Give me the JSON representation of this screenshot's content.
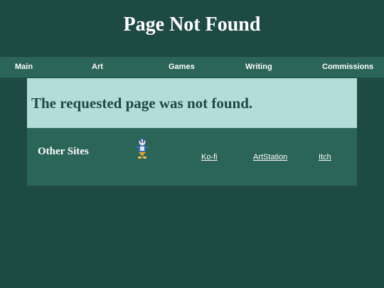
{
  "header": {
    "title": "Page Not Found"
  },
  "nav": {
    "items": [
      {
        "label": "Main"
      },
      {
        "label": "Art"
      },
      {
        "label": "Games"
      },
      {
        "label": "Writing"
      },
      {
        "label": "Commissions"
      }
    ]
  },
  "error": {
    "message": "The requested page was not found."
  },
  "other_sites": {
    "heading": "Other Sites",
    "mascot_icon": "mascot-character-icon",
    "links": [
      {
        "label": "Ko-fi"
      },
      {
        "label": "ArtStation"
      },
      {
        "label": "Itch"
      }
    ]
  },
  "colors": {
    "background": "#1e4a44",
    "nav_bar": "#2b6557",
    "error_panel": "#b3ddd9",
    "text_light": "#ffffff"
  }
}
